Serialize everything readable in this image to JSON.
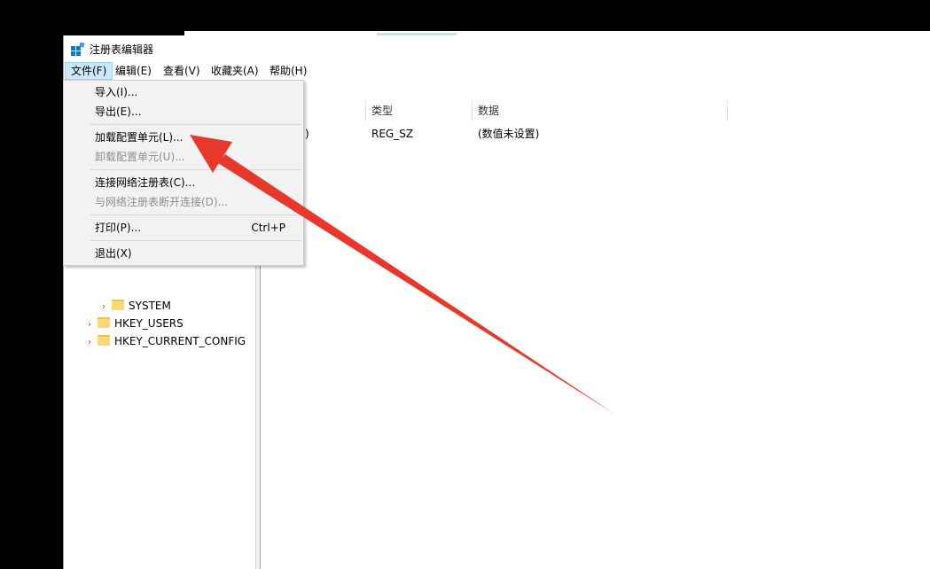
{
  "window": {
    "title": "注册表编辑器"
  },
  "menubar": {
    "file": "文件(F)",
    "edit": "编辑(E)",
    "view": "查看(V)",
    "favorites": "收藏夹(A)",
    "help": "帮助(H)"
  },
  "file_menu": {
    "import": "导入(I)...",
    "export": "导出(E)...",
    "load_hive": "加载配置单元(L)...",
    "unload_hive": "卸载配置单元(U)...",
    "connect_network": "连接网络注册表(C)...",
    "disconnect_network": "与网络注册表断开连接(D)...",
    "print": "打印(P)...",
    "print_shortcut": "Ctrl+P",
    "exit": "退出(X)"
  },
  "tree": {
    "items": [
      {
        "label": "SYSTEM"
      },
      {
        "label": "HKEY_USERS"
      },
      {
        "label": "HKEY_CURRENT_CONFIG"
      }
    ]
  },
  "list": {
    "headers": {
      "name": "",
      "type": "类型",
      "data": "数据"
    },
    "rows": [
      {
        "name_partial": ")",
        "type": "REG_SZ",
        "data": "(数值未设置)"
      }
    ]
  },
  "annotation": {
    "arrow_color": "#e8382b"
  }
}
